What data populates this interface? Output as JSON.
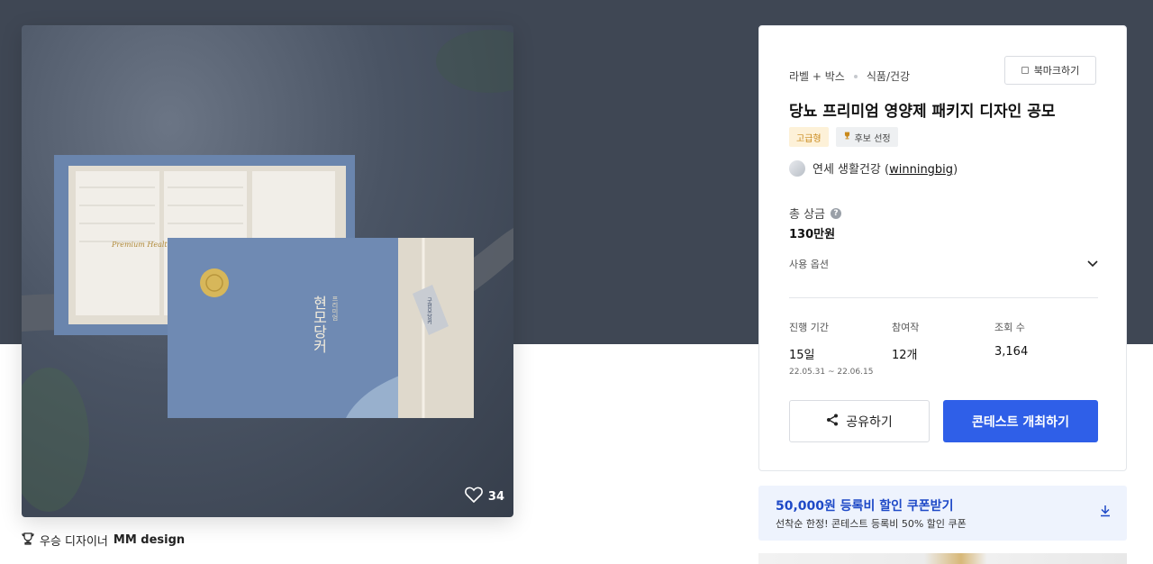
{
  "product": {
    "likes": "34",
    "box_brand": "현모당커",
    "box_subtitle": "프리미엄",
    "box_english": "Premium Healthy",
    "tag_text": "구현모당커"
  },
  "winner": {
    "label": "우승 디자이너",
    "name": "MM design"
  },
  "contest": {
    "category_1": "라벨 + 박스",
    "category_2": "식품/건강",
    "bookmark_label": "북마크하기",
    "title": "당뇨 프리미엄 영양제 패키지 디자인 공모",
    "badge_premium": "고급형",
    "badge_candidate": "후보 선정",
    "host_name": "연세 생활건강 (",
    "host_id": "winningbig",
    "host_close": ")",
    "prize_label": "총 상금",
    "prize_value": "130만원",
    "options_label": "사용 옵션",
    "stats": {
      "period_label": "진행 기간",
      "period_value": "15일",
      "period_range": "22.05.31  ~  22.06.15",
      "entries_label": "참여작",
      "entries_value": "12개",
      "views_label": "조회 수",
      "views_value": "3,164"
    },
    "share_label": "공유하기",
    "host_button_label": "콘테스트 개최하기"
  },
  "coupon": {
    "title": "50,000원 등록비 할인 쿠폰받기",
    "subtitle": "선착순 한정! 콘테스트 등록비 50% 할인 쿠폰"
  },
  "colors": {
    "hero_band": "#3f4754",
    "accent_blue": "#2f5fe8",
    "coupon_bg": "#eef3fd",
    "coupon_text": "#1e49c7",
    "badge_premium_bg": "#fdf1d8",
    "badge_premium_text": "#c9891b"
  },
  "icons": [
    "heart-icon",
    "trophy-icon",
    "bookmark-icon",
    "help-icon",
    "chevron-down-icon",
    "share-icon",
    "download-icon"
  ]
}
